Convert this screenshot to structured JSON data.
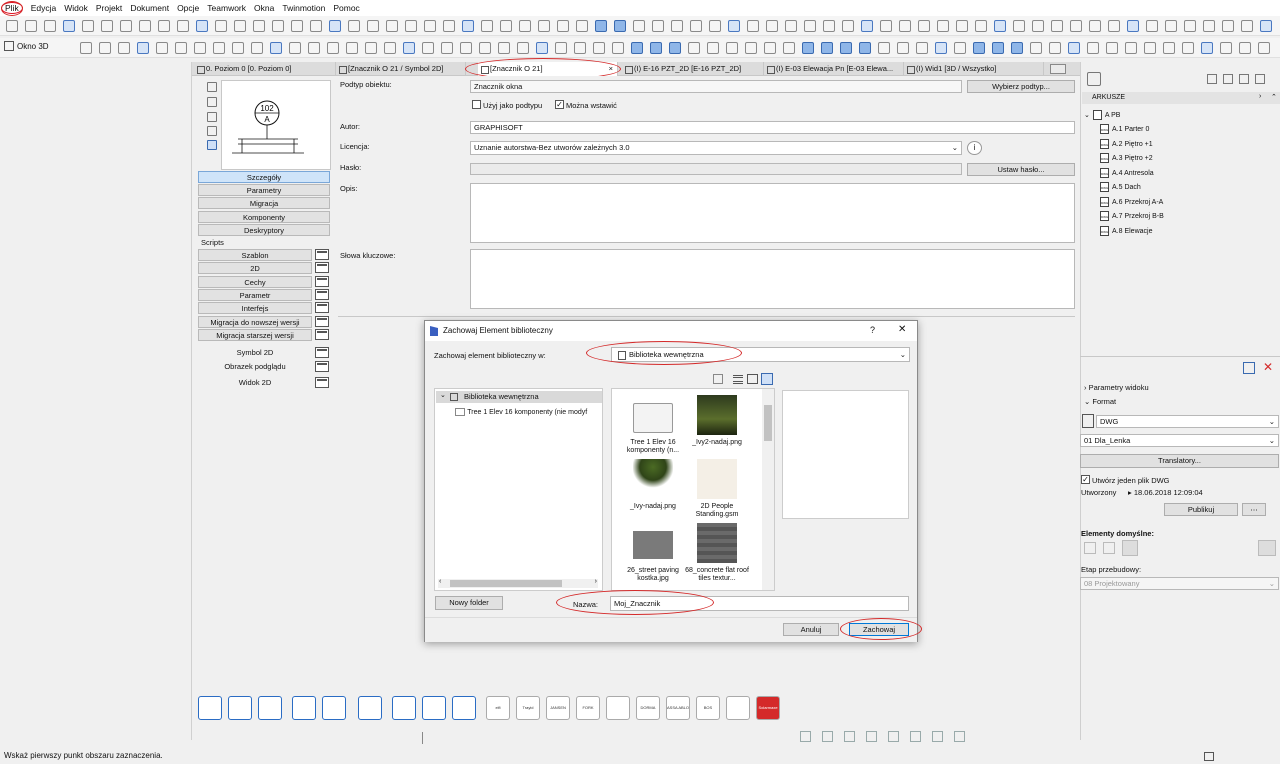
{
  "menu": [
    "Plik",
    "Edycja",
    "Widok",
    "Projekt",
    "Dokument",
    "Opcje",
    "Teamwork",
    "Okna",
    "Twinmotion",
    "Pomoc"
  ],
  "toolbar": {
    "okno3d_label": "Okno 3D"
  },
  "tabs": [
    {
      "label": "0. Poziom 0 [0. Poziom 0]"
    },
    {
      "label": "[Znacznik O 21 / Symbol 2D]"
    },
    {
      "label": "[Znacznik O 21]"
    },
    {
      "label": "(I) E-16 PZT_2D [E-16 PZT_2D]"
    },
    {
      "label": "(I) E-03 Elewacja Pn [E-03 Elewa..."
    },
    {
      "label": "(I) Wid1 [3D / Wszystko]"
    }
  ],
  "preview": {
    "symbol_top": "102",
    "symbol_bottom": "A"
  },
  "left_buttons": {
    "top": [
      "Szczegóły",
      "Parametry",
      "Migracja",
      "Komponenty",
      "Deskryptory"
    ],
    "scripts_label": "Scripts",
    "scripts": [
      "Szablon",
      "2D",
      "Cechy",
      "Parametr",
      "Interfejs",
      "Migracja do nowszej wersji",
      "Migracja starszej wersji"
    ],
    "other": [
      "Symbol 2D",
      "Obrazek podglądu",
      "Widok 2D"
    ]
  },
  "details": {
    "subtype_label": "Podtyp obiektu:",
    "subtype_value": "Znacznik okna",
    "select_subtype_btn": "Wybierz podtyp...",
    "use_as_subtype": "Użyj jako podtypu",
    "can_place": "Można wstawić",
    "author_label": "Autor:",
    "author_value": "GRAPHISOFT",
    "license_label": "Licencja:",
    "license_value": "Uznanie autorstwa-Bez utworów zależnych 3.0",
    "password_label": "Hasło:",
    "set_password_btn": "Ustaw hasło...",
    "description_label": "Opis:",
    "keywords_label": "Słowa kluczowe:"
  },
  "dialog": {
    "title": "Zachowaj Element biblioteczny",
    "help": "?",
    "close": "✕",
    "save_in_label": "Zachowaj element biblioteczny w:",
    "save_in_value": "Biblioteka wewnętrzna",
    "tree_root": "Biblioteka wewnętrzna",
    "tree_child": "Tree 1 Elev 16 komponenty (nie modyf",
    "files": [
      {
        "name": "Tree 1 Elev 16 komponenty (n...",
        "kind": "folder"
      },
      {
        "name": "_Ivy2-nadaj.png",
        "kind": "ivy2"
      },
      {
        "name": "_Ivy-nadaj.png",
        "kind": "ivy"
      },
      {
        "name": "2D People Standing.gsm",
        "kind": "people"
      },
      {
        "name": "26_street paving kostka.jpg",
        "kind": "paving"
      },
      {
        "name": "68_concrete flat roof tiles textur...",
        "kind": "roof"
      }
    ],
    "new_folder_btn": "Nowy folder",
    "name_label": "Nazwa:",
    "name_value": "Moj_Znacznik",
    "cancel_btn": "Anuluj",
    "save_btn": "Zachowaj"
  },
  "right_panel": {
    "header": "ARKUSZE",
    "root": "A PB",
    "sheets": [
      "A.1 Parter 0",
      "A.2 Piętro +1",
      "A.3 Piętro +2",
      "A.4 Antresola",
      "A.5 Dach",
      "A.6 Przekroj A-A",
      "A.7 Przekroj B-B",
      "A.8 Elewacje"
    ],
    "view_params": "Parametry widoku",
    "format_label": "Format",
    "format_value": "DWG",
    "translator_value": "01 Dla_Lenka",
    "translators_btn": "Translatory...",
    "one_file": "Utwórz jeden plik DWG",
    "created_label": "Utworzony",
    "created_value": "18.06.2018 12:09:04",
    "publish_btn": "Publikuj",
    "default_elements": "Elementy domyślne:",
    "phase_label": "Etap przebudowy:",
    "phase_value": "08 Projektowany"
  },
  "bottom_brands": [
    "elfi",
    "Trayid",
    "JANSEN",
    "FORK",
    "",
    "DORMA",
    "ASSA ABLOY",
    "BOS",
    "",
    "Solarmaxe"
  ],
  "status": "Wskaż pierwszy punkt obszaru zaznaczenia.",
  "colors": {
    "accent": "#0078d7",
    "highlight": "#cfe4f9",
    "annotation": "#d42a2a"
  }
}
